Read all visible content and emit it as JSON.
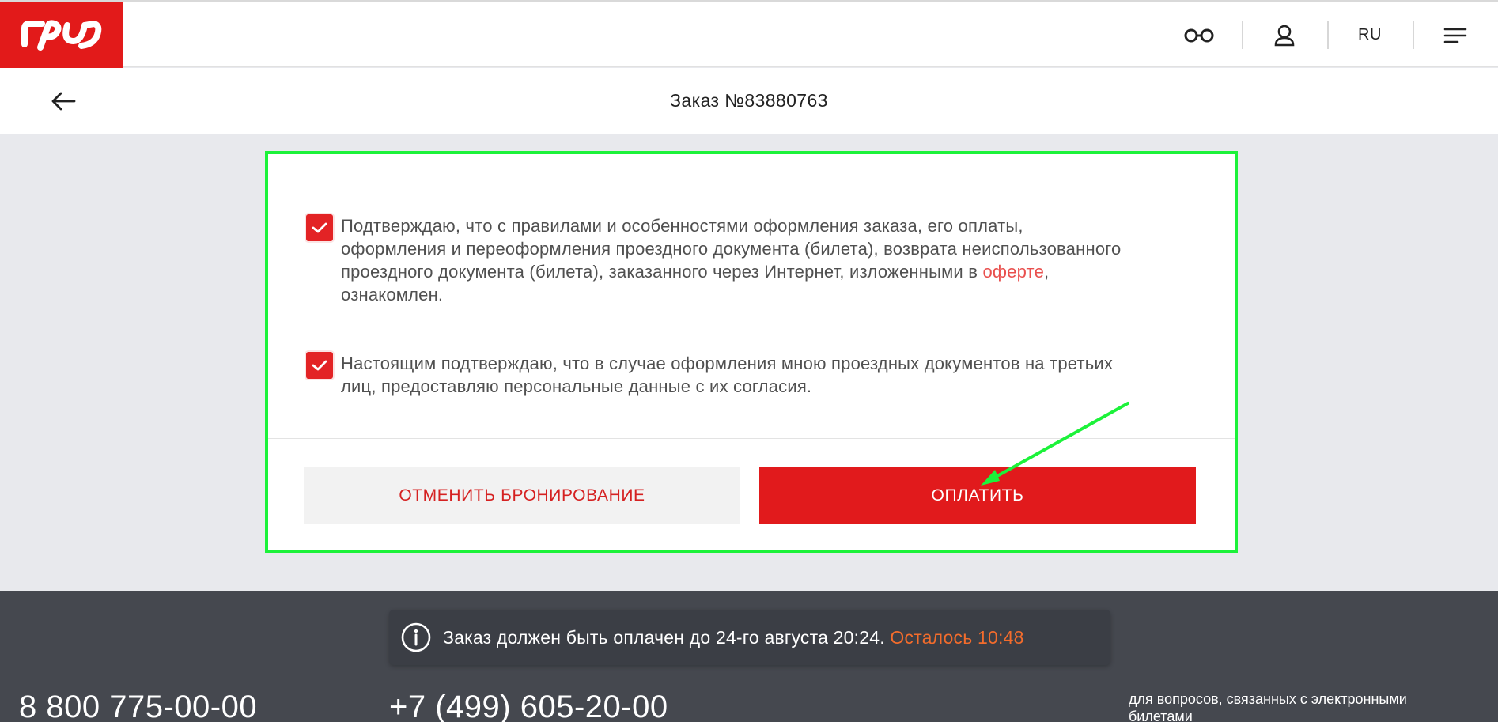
{
  "header": {
    "logo_text": "РЖД",
    "icons": [
      "accessibility-glasses-icon",
      "user-icon",
      "menu-icon"
    ],
    "language": "RU"
  },
  "subheader": {
    "back_icon": "arrow-left-icon",
    "title": "Заказ №83880763"
  },
  "consents": [
    {
      "checked": true,
      "text_before": "Подтверждаю, что с правилами и особенностями оформления заказа, его оплаты, оформления и переоформления проездного документа (билета), возврата неиспользованного проездного документа (билета), заказанного через Интернет, изложенными в ",
      "link_text": "оферте",
      "text_after": ", ознакомлен."
    },
    {
      "checked": true,
      "text": "Настоящим подтверждаю, что в случае оформления мною проездных документов на третьих лиц, предоставляю персональные данные с их согласия."
    }
  ],
  "actions": {
    "cancel_label": "ОТМЕНИТЬ БРОНИРОВАНИЕ",
    "pay_label": "ОПЛАТИТЬ"
  },
  "footer": {
    "timer_text": "Заказ должен быть оплачен до 24-го августа 20:24.",
    "timer_remaining": "Осталось 10:48",
    "phone_1": "8 800 775-00-00",
    "phone_2": "+7 (499) 605-20-00",
    "support_note": "для вопросов, связанных с электронными билетами"
  },
  "colors": {
    "brand_red": "#e21a1a",
    "highlight_green": "#1cf23a",
    "timer_orange": "#f36c2c",
    "footer_bg": "#45484f"
  }
}
